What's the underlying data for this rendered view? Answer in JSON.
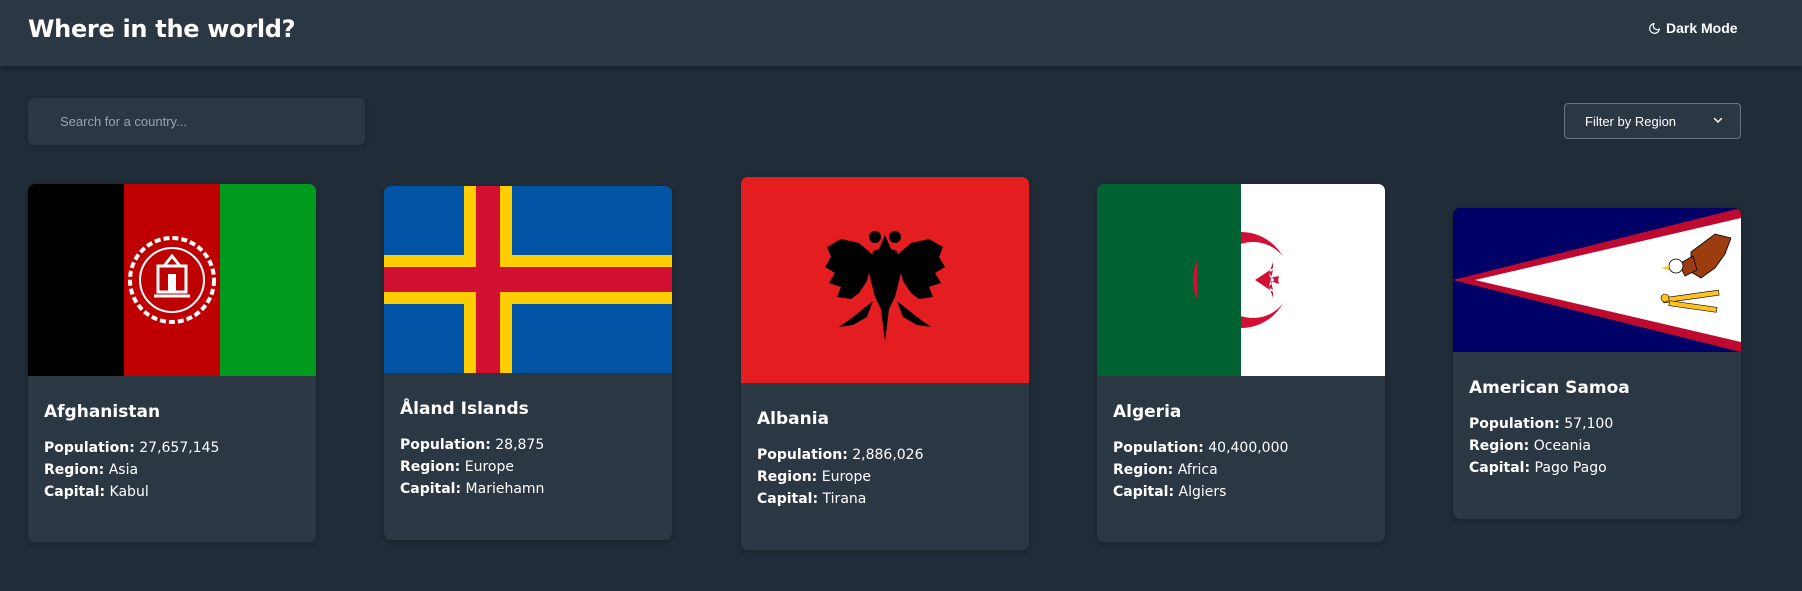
{
  "header": {
    "title": "Where in the world?",
    "theme_toggle_label": "Dark Mode",
    "theme_toggle_icon": "moon-icon"
  },
  "search": {
    "placeholder": "Search for a country...",
    "value": "",
    "icon": "search-icon"
  },
  "filter": {
    "label": "Filter by Region",
    "icon": "chevron-down-icon"
  },
  "labels": {
    "population": "Population:",
    "region": "Region:",
    "capital": "Capital:"
  },
  "countries": [
    {
      "name": "Afghanistan",
      "population": "27,657,145",
      "region": "Asia",
      "capital": "Kabul",
      "flag": "afghanistan-flag"
    },
    {
      "name": "Åland Islands",
      "population": "28,875",
      "region": "Europe",
      "capital": "Mariehamn",
      "flag": "aland-islands-flag"
    },
    {
      "name": "Albania",
      "population": "2,886,026",
      "region": "Europe",
      "capital": "Tirana",
      "flag": "albania-flag"
    },
    {
      "name": "Algeria",
      "population": "40,400,000",
      "region": "Africa",
      "capital": "Algiers",
      "flag": "algeria-flag"
    },
    {
      "name": "American Samoa",
      "population": "57,100",
      "region": "Oceania",
      "capital": "Pago Pago",
      "flag": "american-samoa-flag"
    }
  ],
  "colors": {
    "background": "#202c37",
    "surface": "#2b3743",
    "text": "#ffffff",
    "placeholder": "#9aa3ab"
  }
}
